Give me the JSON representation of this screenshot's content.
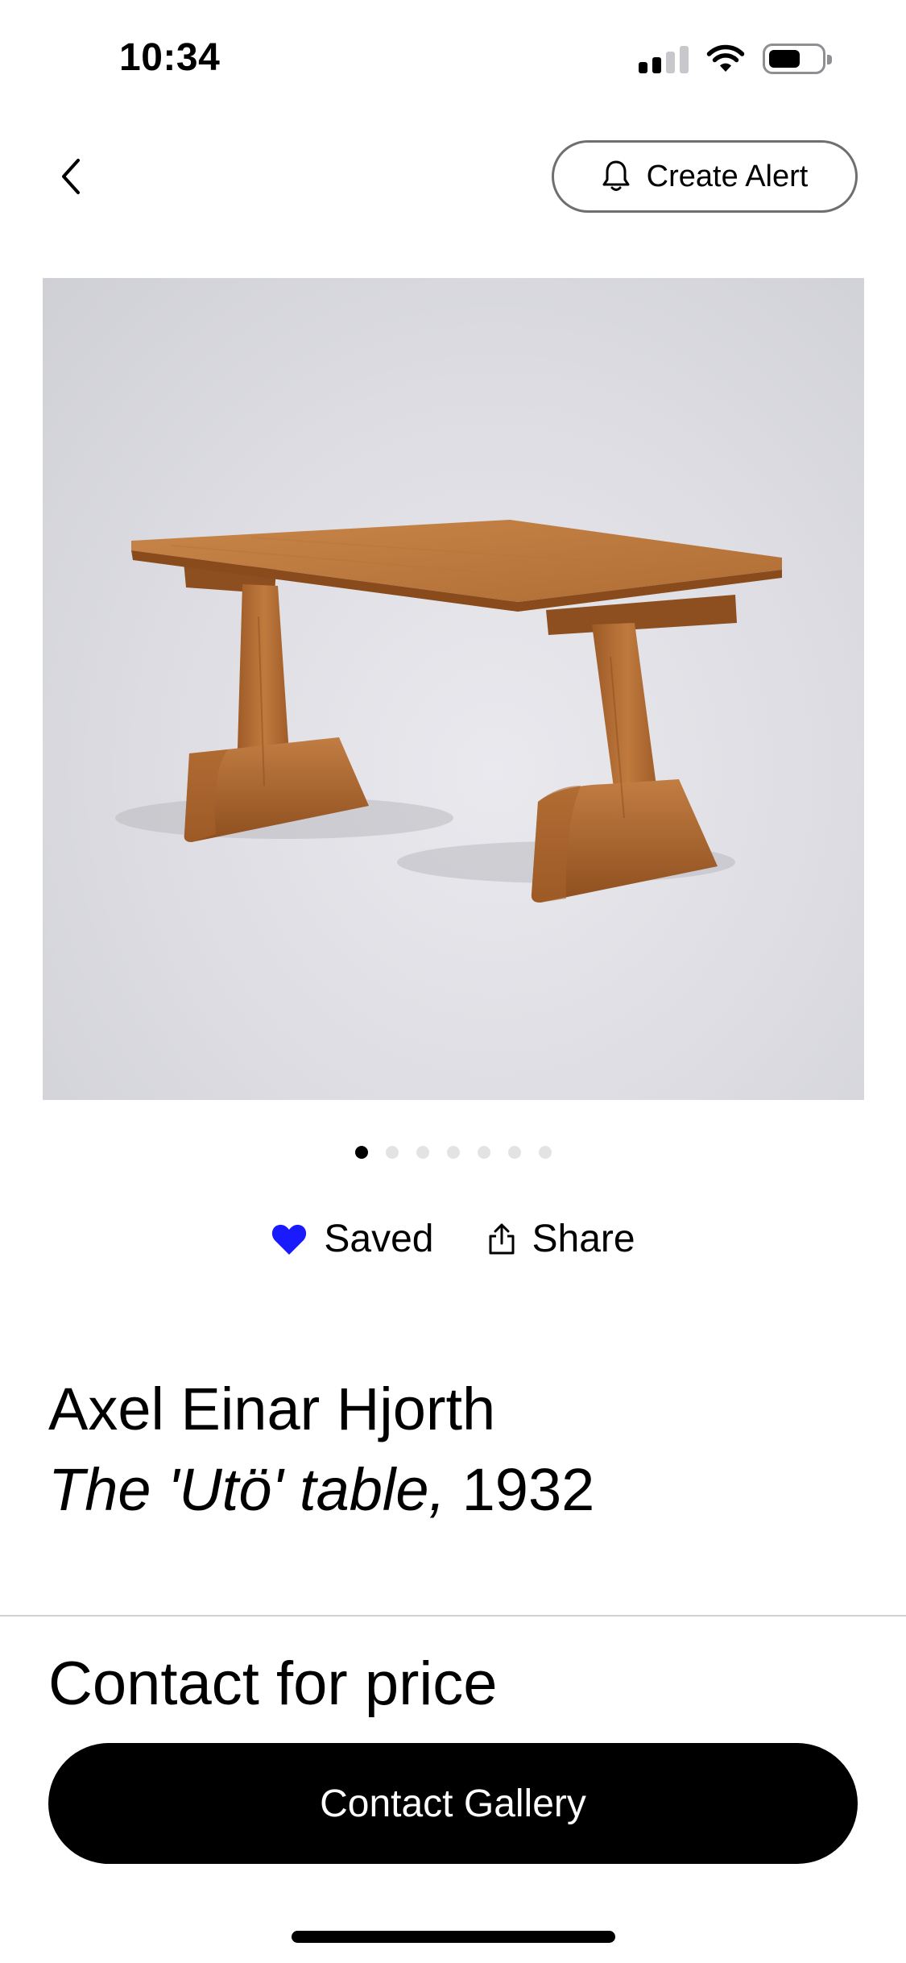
{
  "status_bar": {
    "time": "10:34",
    "icons": [
      "cellular-signal-icon",
      "wifi-icon",
      "battery-icon"
    ]
  },
  "header": {
    "back_icon": "chevron-left-icon",
    "alert_icon": "bell-icon",
    "create_alert_label": "Create Alert"
  },
  "artwork_image": {
    "subject": "wooden table",
    "image_count": 7,
    "active_index": 0
  },
  "actions": {
    "saved": {
      "label": "Saved",
      "icon": "heart-filled-icon",
      "color": "#1a1aff"
    },
    "share": {
      "label": "Share",
      "icon": "share-icon"
    }
  },
  "artwork": {
    "artist": "Axel Einar Hjorth",
    "title": "The 'Utö' table,",
    "year": "1932"
  },
  "pricing": {
    "price_text": "Contact for price",
    "contact_button_label": "Contact Gallery"
  },
  "colors": {
    "accent_blue": "#1a1aff",
    "primary": "#000000",
    "background": "#ffffff"
  }
}
